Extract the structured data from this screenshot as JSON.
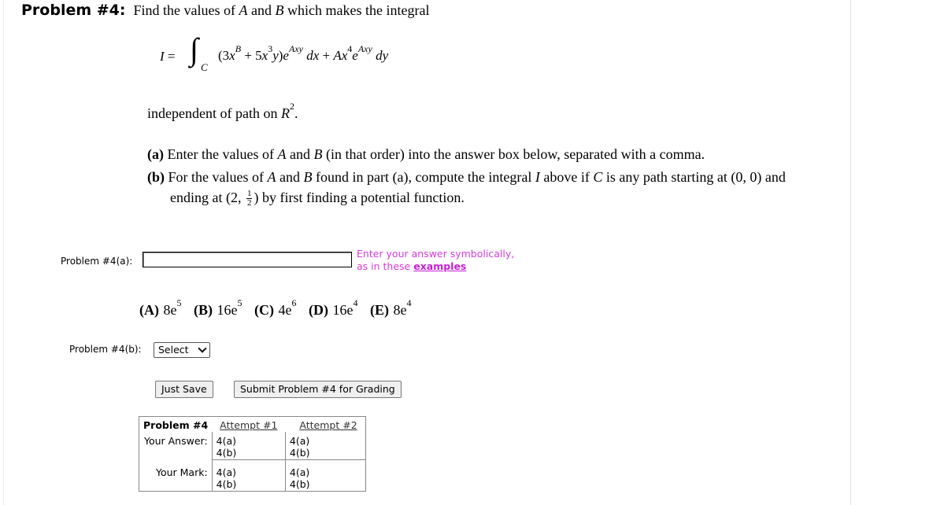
{
  "problem": {
    "title": "Problem #4:",
    "statement": "Find the values of A and B which makes the integral",
    "integral_lhs": "I =",
    "integral_sub": "C",
    "independent_text": "independent of path on R",
    "part_a_label": "(a)",
    "part_a_text": "Enter the values of A and B (in that order) into the answer box below, separated with a comma.",
    "part_b_label": "(b)",
    "part_b_text_1": "For the values of A and B found in part (a), compute the integral I above if C is any path starting at (0, 0) and",
    "part_b_text_2": "ending at (2,",
    "part_b_text_3": ") by first finding a potential function.",
    "frac_num": "1",
    "frac_den": "2"
  },
  "part_a": {
    "label": "Problem #4(a):",
    "input_value": "",
    "hint_line1": "Enter your answer symbolically,",
    "hint_line2": "as in these ",
    "hint_link": "examples"
  },
  "choices": [
    {
      "letter": "(A)",
      "value": "8e",
      "exp": "5"
    },
    {
      "letter": "(B)",
      "value": "16e",
      "exp": "5"
    },
    {
      "letter": "(C)",
      "value": "4e",
      "exp": "6"
    },
    {
      "letter": "(D)",
      "value": "16e",
      "exp": "4"
    },
    {
      "letter": "(E)",
      "value": "8e",
      "exp": "4"
    }
  ],
  "part_b": {
    "label": "Problem #4(b):",
    "select_value": "Select"
  },
  "buttons": {
    "just_save": "Just Save",
    "submit": "Submit Problem #4 for Grading"
  },
  "attempts": {
    "header": "Problem #4",
    "attempt1": "Attempt #1",
    "attempt2": "Attempt #2",
    "your_answer": "Your Answer:",
    "your_mark": "Your Mark:",
    "a": "4(a)",
    "b": "4(b)"
  }
}
